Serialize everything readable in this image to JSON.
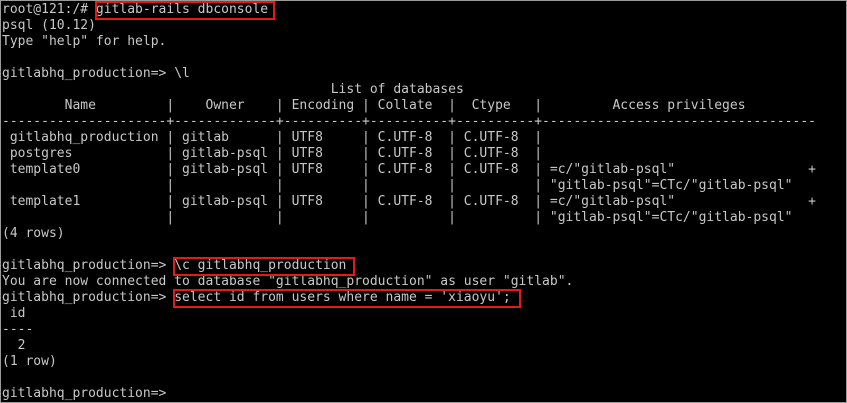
{
  "terminal": {
    "lines": [
      {
        "prompt": "root@121:/# ",
        "command": "gitlab-rails dbconsole"
      },
      {
        "text": "psql (10.12)"
      },
      {
        "text": "Type \"help\" for help."
      },
      {
        "text": ""
      },
      {
        "prompt": "gitlabhq_production=> ",
        "command": "\\l"
      },
      {
        "text": "                                          List of databases"
      },
      {
        "text": "        Name         |    Owner    | Encoding | Collate  |  Ctype   |         Access privileges"
      },
      {
        "text": "---------------------+-------------+----------+----------+----------+-----------------------------------"
      },
      {
        "text": " gitlabhq_production | gitlab      | UTF8     | C.UTF-8  | C.UTF-8  |"
      },
      {
        "text": " postgres            | gitlab-psql | UTF8     | C.UTF-8  | C.UTF-8  |"
      },
      {
        "text": " template0           | gitlab-psql | UTF8     | C.UTF-8  | C.UTF-8  | =c/\"gitlab-psql\"                 +"
      },
      {
        "text": "                     |             |          |          |          | \"gitlab-psql\"=CTc/\"gitlab-psql\""
      },
      {
        "text": " template1           | gitlab-psql | UTF8     | C.UTF-8  | C.UTF-8  | =c/\"gitlab-psql\"                 +"
      },
      {
        "text": "                     |             |          |          |          | \"gitlab-psql\"=CTc/\"gitlab-psql\""
      },
      {
        "text": "(4 rows)"
      },
      {
        "text": ""
      },
      {
        "prompt": "gitlabhq_production=> ",
        "command": "\\c gitlabhq_production"
      },
      {
        "text": "You are now connected to database \"gitlabhq_production\" as user \"gitlab\"."
      },
      {
        "prompt": "gitlabhq_production=> ",
        "command": "select id from users where name = 'xiaoyu';"
      },
      {
        "text": " id"
      },
      {
        "text": "----"
      },
      {
        "text": "  2"
      },
      {
        "text": "(1 row)"
      },
      {
        "text": ""
      },
      {
        "prompt": "gitlabhq_production=> ",
        "command": ""
      }
    ]
  },
  "colors": {
    "background": "#000000",
    "foreground": "#c8c8c8",
    "highlight": "#e21a1a"
  }
}
